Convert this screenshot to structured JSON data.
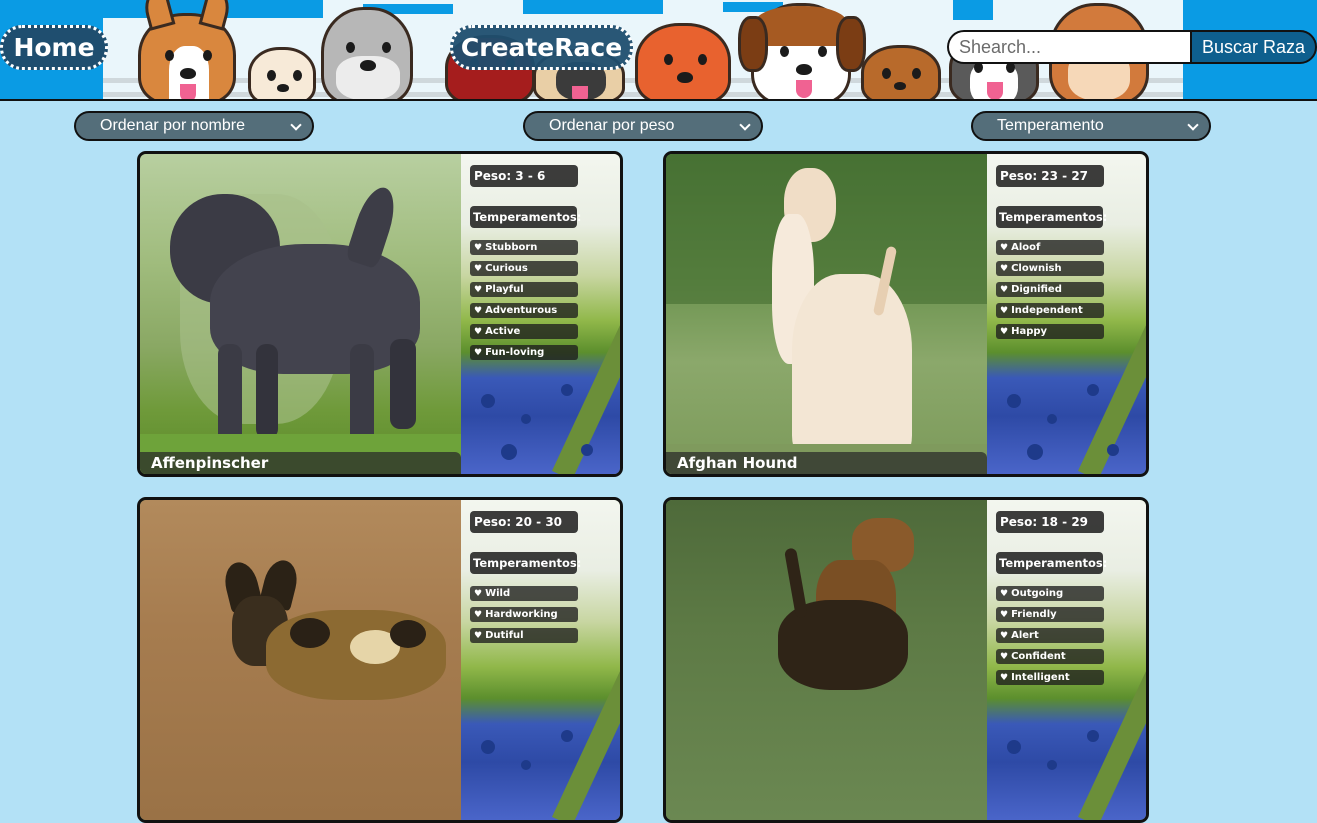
{
  "nav": {
    "home_label": "Home",
    "create_label": "CreateRace"
  },
  "search": {
    "placeholder": "Shearch...",
    "value": "",
    "button_label": "Buscar Raza"
  },
  "filters": {
    "sort_name": "Ordenar por nombre",
    "sort_weight": "Ordenar por peso",
    "temperament": "Temperamento"
  },
  "cards": [
    {
      "name": "Affenpinscher",
      "weight": "Peso: 3 - 6",
      "temperaments_title": "Temperamentos:",
      "temperaments": [
        "Stubborn",
        "Curious",
        "Playful",
        "Adventurous",
        "Active",
        "Fun-loving"
      ]
    },
    {
      "name": "Afghan Hound",
      "weight": "Peso: 23 - 27",
      "temperaments_title": "Temperamentos:",
      "temperaments": [
        "Aloof",
        "Clownish",
        "Dignified",
        "Independent",
        "Happy"
      ]
    },
    {
      "name": "",
      "weight": "Peso: 20 - 30",
      "temperaments_title": "Temperamentos:",
      "temperaments": [
        "Wild",
        "Hardworking",
        "Dutiful"
      ]
    },
    {
      "name": "",
      "weight": "Peso: 18 - 29",
      "temperaments_title": "Temperamentos:",
      "temperaments": [
        "Outgoing",
        "Friendly",
        "Alert",
        "Confident",
        "Intelligent"
      ]
    }
  ],
  "colors": {
    "page_background": "#b3e1f6",
    "header_blue": "#0a9be4",
    "nav_pill": "#1f4e6f",
    "search_button": "#0e5f8e",
    "filter_background": "#546e7a"
  }
}
